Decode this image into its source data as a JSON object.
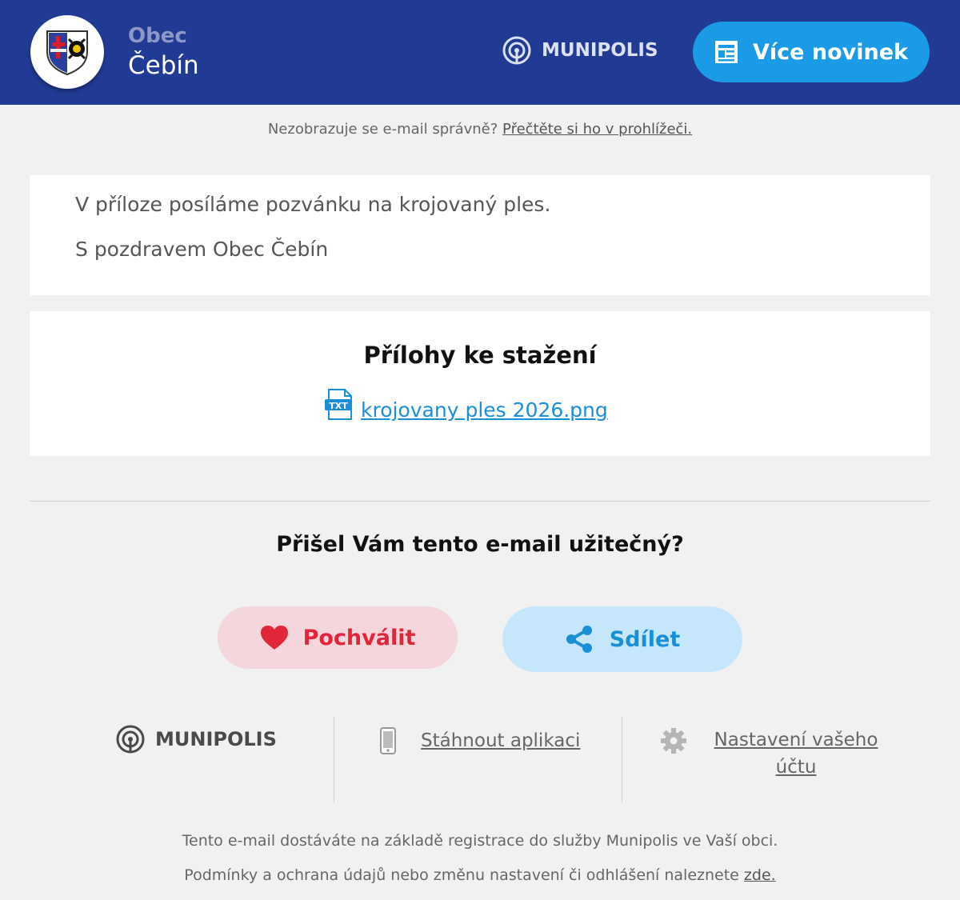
{
  "header": {
    "town_prefix": "Obec",
    "town_name": "Čebín",
    "brand": "MUNIPOLIS",
    "more_news_label": "Více novinek"
  },
  "notice": {
    "text": "Nezobrazuje se e-mail správně?",
    "link": "Přečtěte si ho v prohlížeči."
  },
  "message": {
    "line1": "V příloze posíláme pozvánku na krojovaný ples.",
    "line2": "S pozdravem Obec Čebín"
  },
  "attachments": {
    "title": "Přílohy ke stažení",
    "file_icon_label": "TXT",
    "files": [
      "krojovany ples 2026.png"
    ]
  },
  "feedback": {
    "question": "Přišel Vám tento e-mail užitečný?",
    "praise_label": "Pochválit",
    "share_label": "Sdílet"
  },
  "footer": {
    "brand": "MUNIPOLIS",
    "download_app": "Stáhnout aplikaci",
    "account_settings": "Nastavení vašeho účtu",
    "registration_note": "Tento e-mail dostáváte na základě registrace do služby Munipolis ve Vaší obci.",
    "terms_text": "Podmínky a ochrana údajů nebo změnu nastavení či odhlášení naleznete",
    "terms_link": "zde."
  },
  "colors": {
    "header_bg": "#213a93",
    "accent_blue": "#1b9be5",
    "praise_red": "#e1263a",
    "praise_bg": "#f4d6dc",
    "share_bg": "#c6e7fb",
    "page_bg": "#f1f1f1"
  },
  "icons": {
    "coat_of_arms": "coat-of-arms-icon",
    "munipolis": "munipolis-logo-icon",
    "news": "newspaper-icon",
    "file": "txt-file-icon",
    "heart": "heart-icon",
    "share": "share-icon",
    "phone": "phone-icon",
    "gear": "gear-icon"
  }
}
